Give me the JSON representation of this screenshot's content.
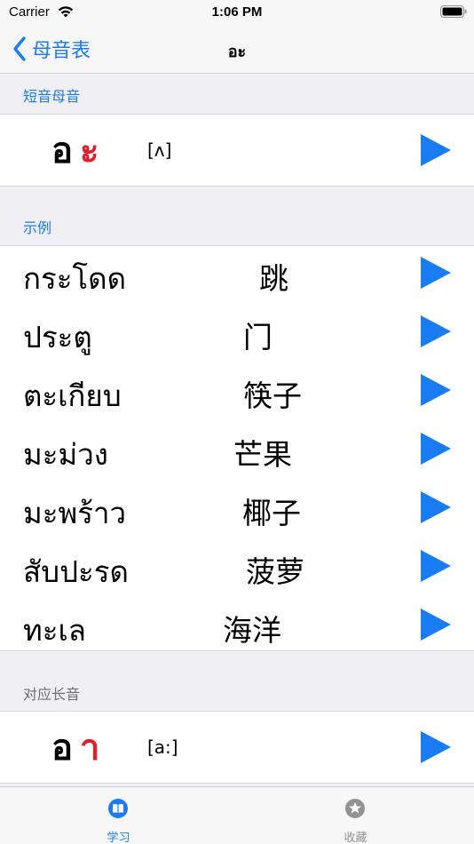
{
  "status_bar": {
    "carrier": "Carrier",
    "time": "1:06 PM"
  },
  "nav": {
    "back_label": "母音表",
    "title": "อะ"
  },
  "short_vowel": {
    "header": "短音母音",
    "glyph_base": "อ",
    "glyph_vowel": "ะ",
    "ipa": "[ʌ]"
  },
  "examples": {
    "header": "示例",
    "items": [
      {
        "thai": "กระโดด",
        "chinese": "跳"
      },
      {
        "thai": "ประตู",
        "chinese": "门"
      },
      {
        "thai": "ตะเกียบ",
        "chinese": "筷子"
      },
      {
        "thai": "มะม่วง",
        "chinese": "芒果"
      },
      {
        "thai": "มะพร้าว",
        "chinese": "椰子"
      },
      {
        "thai": "สับปะรด",
        "chinese": "菠萝"
      },
      {
        "thai": "ทะเล",
        "chinese": "海洋"
      }
    ]
  },
  "long_vowel": {
    "header": "对应长音",
    "glyph_base": "อ",
    "glyph_vowel": "า",
    "ipa": "[a:]"
  },
  "tab_bar": {
    "tabs": [
      {
        "label": "学习",
        "icon": "book-icon",
        "active": true
      },
      {
        "label": "收藏",
        "icon": "star-icon",
        "active": false
      }
    ]
  },
  "colors": {
    "accent": "#1a7cf2",
    "glyph_vowel": "#e0202a",
    "background": "#efeff4"
  }
}
